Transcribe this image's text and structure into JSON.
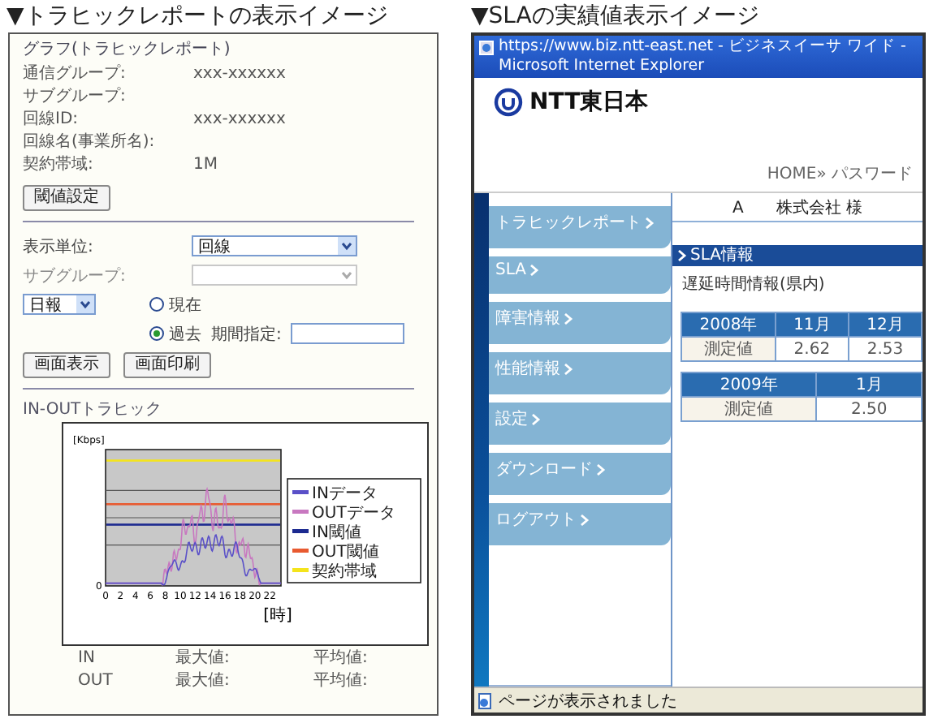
{
  "left": {
    "heading": "▼トラヒックレポートの表示イメージ",
    "title": "グラフ(トラヒックレポート)",
    "info": [
      {
        "label": "通信グループ:",
        "value": "xxx-xxxxxx"
      },
      {
        "label": "サブグループ:"
      },
      {
        "label": "回線ID:",
        "value": "xxx-xxxxxx"
      },
      {
        "label": "回線名(事業所名):"
      },
      {
        "label": "契約帯域:",
        "value": "1M"
      }
    ],
    "threshold_button": "閾値設定",
    "display_unit": {
      "label": "表示単位:",
      "value": "回線"
    },
    "subgroup": {
      "label": "サブグループ:",
      "disabled": true
    },
    "period": {
      "value": "日報"
    },
    "radios": [
      {
        "label": "現在",
        "selected": false
      },
      {
        "label": "過去",
        "selected": true
      }
    ],
    "date_field": {
      "label": "期間指定:"
    },
    "buttons": [
      "画面表示",
      "画面印刷"
    ],
    "chart": {
      "title": "IN-OUTトラヒック",
      "ylabel": "[Kbps]",
      "y_zero": "0",
      "xticks": [
        "0",
        "2",
        "4",
        "6",
        "8",
        "10",
        "12",
        "14",
        "16",
        "18",
        "20",
        "22"
      ],
      "xunit": "[時]",
      "legend": [
        {
          "label": "INデータ",
          "color": "#5a50c8"
        },
        {
          "label": "OUTデータ",
          "color": "#c878c0"
        },
        {
          "label": "IN閾値",
          "color": "#1c2a90"
        },
        {
          "label": "OUT閾値",
          "color": "#e85a30"
        },
        {
          "label": "契約帯域",
          "color": "#f4e41c"
        }
      ]
    },
    "stats": [
      {
        "name": "IN",
        "max_label": "最大値:",
        "avg_label": "平均値:"
      },
      {
        "name": "OUT",
        "max_label": "最大値:",
        "avg_label": "平均値:"
      }
    ]
  },
  "right": {
    "heading": "▼SLAの実績値表示イメージ",
    "browser": {
      "title": "https://www.biz.ntt-east.net - ビジネスイーサ ワイド - Microsoft Internet Explorer",
      "status": "ページが表示されました"
    },
    "logo": "NTT東日本",
    "breadcrumb": "HOME» パスワード",
    "menu": [
      "トラヒックレポート",
      "SLA",
      "障害情報",
      "性能情報",
      "設定",
      "ダウンロード",
      "ログアウト"
    ],
    "customer": "A　　株式会社 様",
    "section": "SLA情報",
    "subheading": "遅延時間情報(県内)",
    "tables": [
      {
        "headers": [
          "2008年",
          "11月",
          "12月"
        ],
        "row": [
          "測定値",
          "2.62",
          "2.53"
        ]
      },
      {
        "headers": [
          "2009年",
          "1月"
        ],
        "row": [
          "測定値",
          "2.50"
        ]
      }
    ]
  }
}
